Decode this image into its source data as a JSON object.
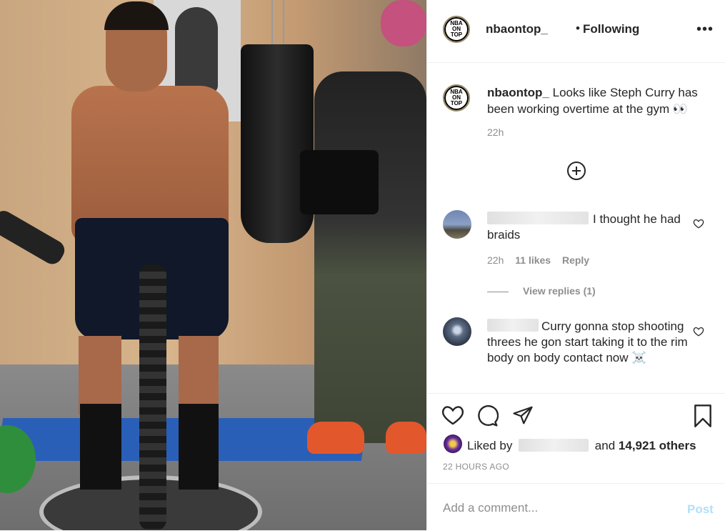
{
  "header": {
    "username": "nbaontop_",
    "separator": "•",
    "follow_status": "Following",
    "more_icon": "more-horizontal-icon",
    "logo_text": "NBA ON TOP"
  },
  "caption": {
    "username": "nbaontop_",
    "text": "Looks like Steph Curry has been working overtime at the gym 👀",
    "time": "22h"
  },
  "load_more_icon": "plus-circle-icon",
  "comments": [
    {
      "text": "I thought he had braids",
      "time": "22h",
      "likes": "11 likes",
      "reply_label": "Reply",
      "view_replies": "View replies (1)"
    },
    {
      "text": "Curry gonna stop shooting threes he gon start taking it to the rim body on body contact now ☠️"
    }
  ],
  "actions": {
    "like_icon": "heart-icon",
    "comment_icon": "comment-icon",
    "share_icon": "paper-plane-icon",
    "save_icon": "bookmark-icon"
  },
  "likes": {
    "prefix": "Liked by",
    "connector": "and",
    "others": "14,921 others"
  },
  "timestamp": "22 HOURS AGO",
  "add_comment": {
    "placeholder": "Add a comment...",
    "post_label": "Post",
    "post_color": "#b2dffc"
  }
}
